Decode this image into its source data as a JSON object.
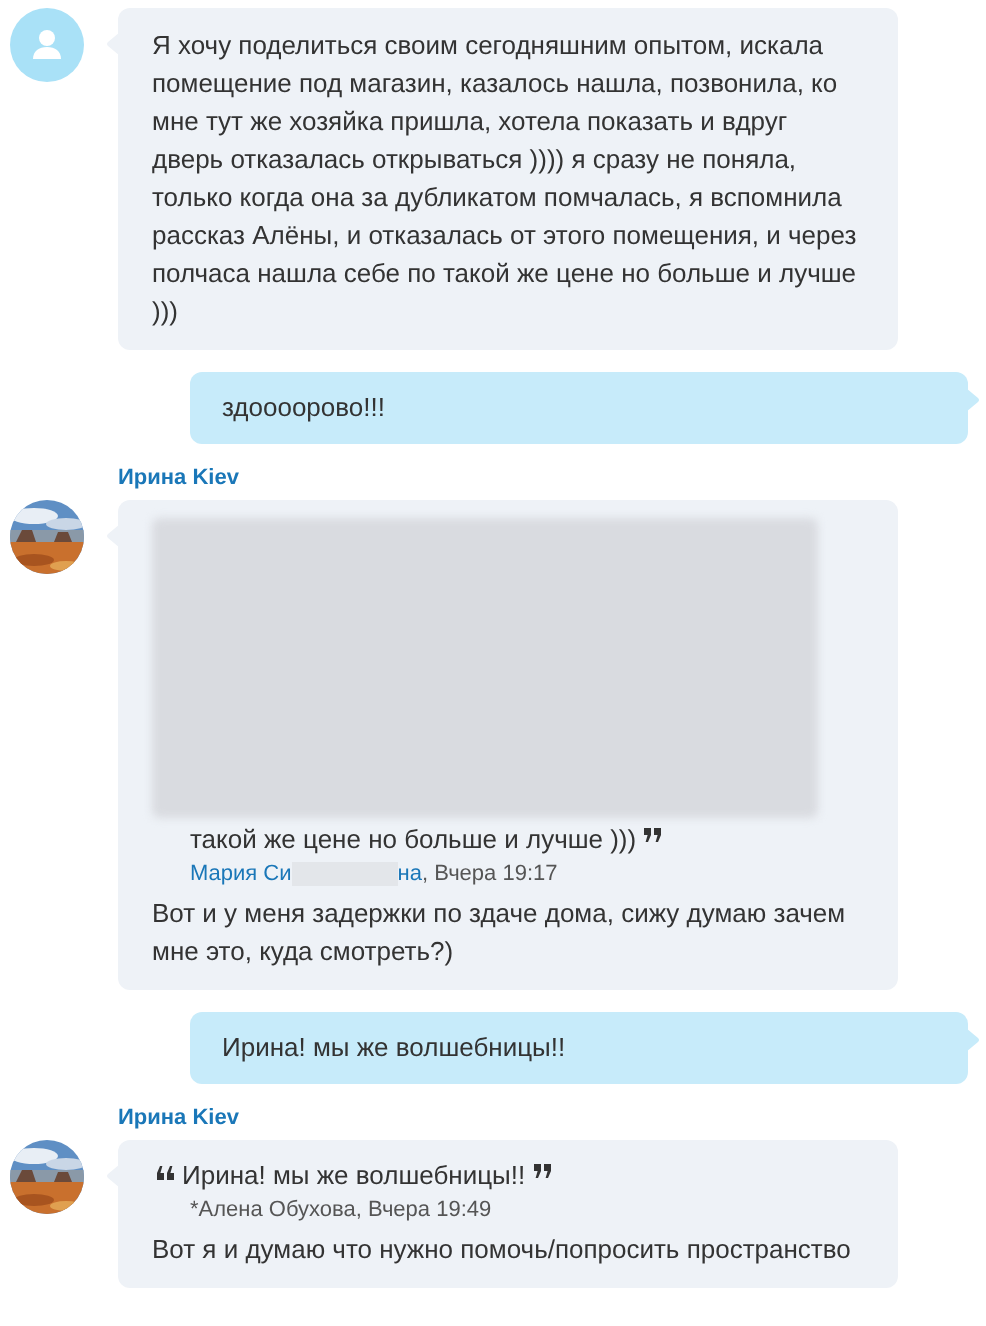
{
  "messages": [
    {
      "kind": "incoming",
      "avatar": {
        "kind": "placeholder"
      },
      "text": "Я хочу поделиться своим сегодняшним опытом, искала помещение под магазин, казалось нашла, позвонила, ко мне тут же хозяйка пришла, хотела показать и вдруг дверь отказалась открываться )))) я сразу не поняла, только когда она за дубликатом помчалась, я вспомнила рассказ Алёны,  и отказалась от этого помещения, и через полчаса нашла себе по такой же цене но больше и лучше )))"
    },
    {
      "kind": "outgoing",
      "text": "здоооорово!!!"
    },
    {
      "kind": "incoming",
      "sender": "Ирина Kiev",
      "quote": {
        "redacted": true,
        "open_mark": false,
        "text": "такой же цене но больше и лучше )))",
        "author": "Мария Си",
        "author_redacted": true,
        "author_tail": "на",
        "author_link": true,
        "meta": ", Вчера 19:17"
      },
      "text": "Вот и у меня задержки по здаче дома, сижу думаю зачем мне это, куда смотреть?)"
    },
    {
      "kind": "outgoing",
      "text": "Ирина! мы же волшебницы!!"
    },
    {
      "kind": "incoming",
      "sender": "Ирина Kiev",
      "quote": {
        "redacted": false,
        "open_mark": true,
        "text": "Ирина! мы же волшебницы!!",
        "author": "*Алена Обухова",
        "author_redacted": false,
        "author_link": false,
        "meta": ", Вчера 19:49"
      },
      "text": "Вот я и думаю что нужно помочь/попросить пространство"
    }
  ]
}
